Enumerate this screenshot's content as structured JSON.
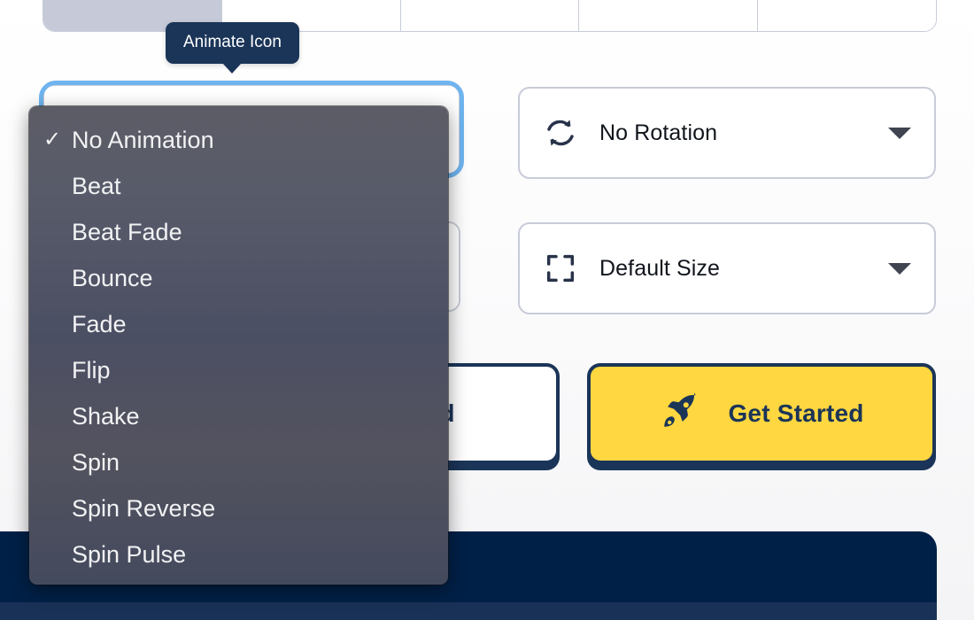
{
  "tooltip": {
    "text": "Animate Icon"
  },
  "icon_grid": {
    "name": "icon-style-preview-row",
    "cells": [
      {
        "id": "icon-solid-navy",
        "style": "solid",
        "color": "#1b3558",
        "selected": true
      },
      {
        "id": "icon-outline-blue",
        "style": "outline",
        "color": "#1d6fc4",
        "selected": false
      },
      {
        "id": "icon-outline-blue-2",
        "style": "outline",
        "color": "#1d6fc4",
        "selected": false
      },
      {
        "id": "icon-solid-lightblue",
        "style": "solid",
        "color": "#92bce4",
        "selected": false
      },
      {
        "id": "icon-outline-lightblue",
        "style": "outline",
        "color": "#7fb0e0",
        "selected": false
      }
    ]
  },
  "controls": {
    "animation": {
      "name": "animation-select",
      "value": "No Animation",
      "expanded": true,
      "options": [
        "No Animation",
        "Beat",
        "Beat Fade",
        "Bounce",
        "Fade",
        "Flip",
        "Shake",
        "Spin",
        "Spin Reverse",
        "Spin Pulse"
      ],
      "selected_index": 0,
      "check_glyph": "✓"
    },
    "style": {
      "name": "icon-style-select",
      "value": ""
    },
    "rotation": {
      "name": "rotation-select",
      "icon": "rotate-icon",
      "value": "No Rotation"
    },
    "size": {
      "name": "size-select",
      "icon": "expand-icon",
      "value": "Default Size"
    }
  },
  "actions": {
    "secondary": {
      "name": "wizard-button",
      "label": "zard"
    },
    "primary": {
      "name": "get-started-button",
      "label": "Get Started",
      "icon": "rocket-icon"
    }
  },
  "colors": {
    "tooltip_bg": "#1b3558",
    "focus_ring": "#6fb4ef",
    "accent_yellow": "#ffd740",
    "navy": "#1b3558",
    "footer_navy": "#012047",
    "footer_strip": "#1a3157",
    "border_gray": "#c8ccd8",
    "menu_text": "#f2f2f4"
  }
}
